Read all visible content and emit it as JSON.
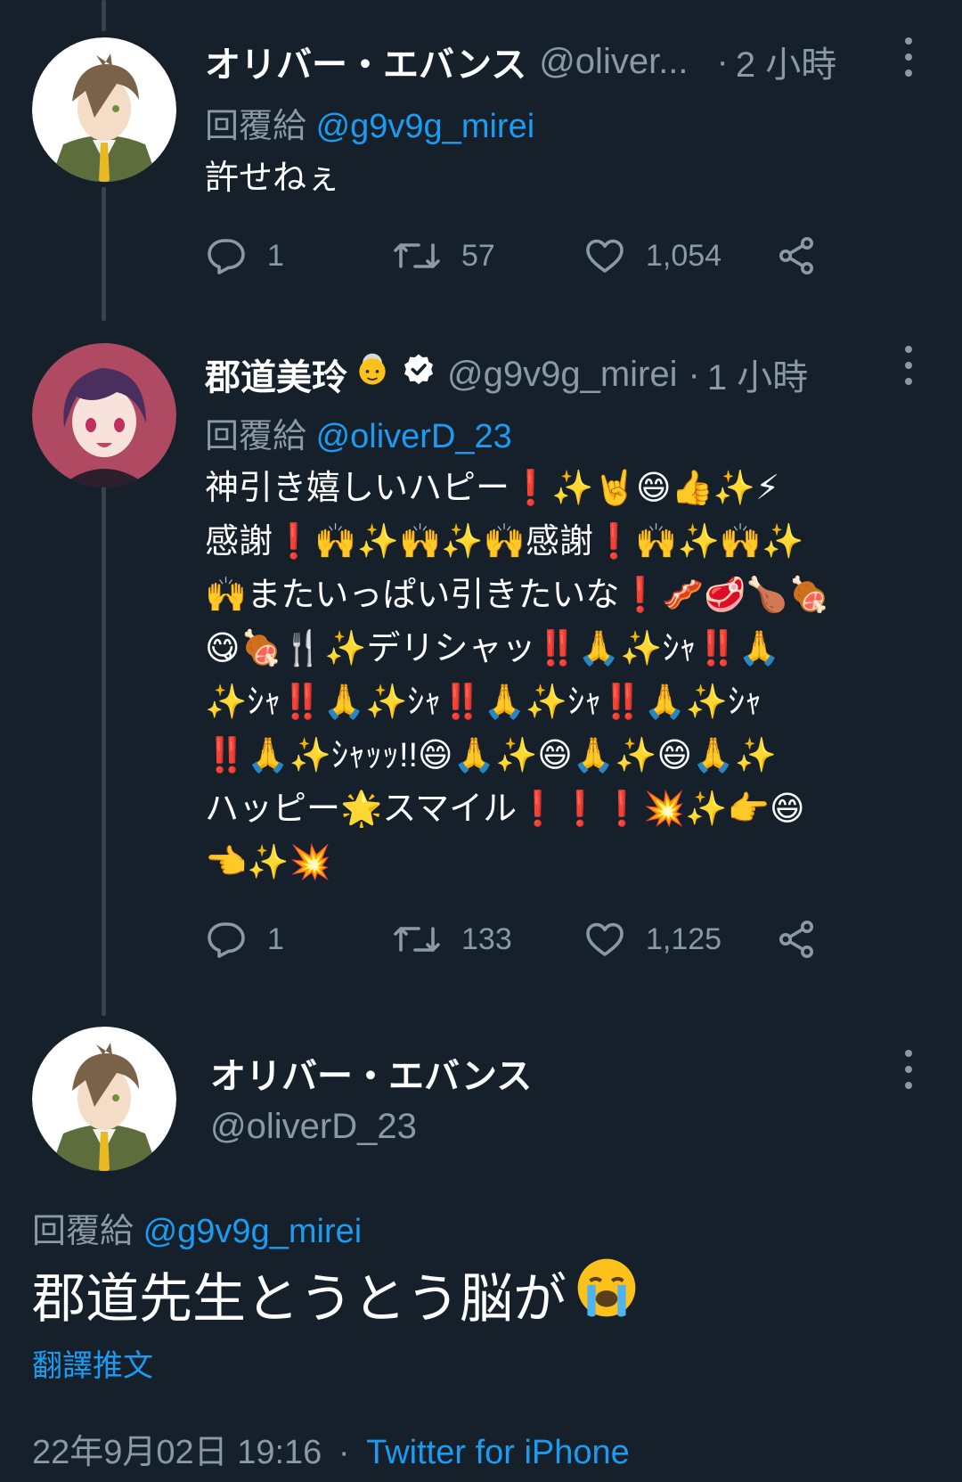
{
  "tweets": [
    {
      "display_name": "オリバー・エバンス",
      "handle": "@oliver...",
      "separator": "·",
      "time": "2 小時",
      "reply_prefix": "回覆給",
      "reply_mention": "@g9v9g_mirei",
      "text": "許せねぇ",
      "replies": "1",
      "retweets": "57",
      "likes": "1,054"
    },
    {
      "display_name": "郡道美玲",
      "handle": "@g9v9g_mirei",
      "separator": "·",
      "time": "1 小時",
      "reply_prefix": "回覆給",
      "reply_mention": "@oliverD_23",
      "text_lines": [
        "神引き嬉しいハピー❗✨🤘😄👍✨⚡",
        "感謝❗🙌✨🙌✨🙌感謝❗🙌✨🙌✨",
        "🙌またいっぱい引きたいな❗🥓🥩🍗🍖",
        "😋🍖🍴✨デリシャッ‼️🙏✨ｼｬ‼️🙏",
        "✨ｼｬ‼️🙏✨ｼｬ‼️🙏✨ｼｬ‼️🙏✨ｼｬ",
        "‼️🙏✨ｼｬｯｯ!!😄🙏✨😄🙏✨😄🙏✨",
        "ハッピー🌟スマイル❗❗❗💥✨👉😄",
        "👈✨💥"
      ],
      "replies": "1",
      "retweets": "133",
      "likes": "1,125"
    }
  ],
  "main_tweet": {
    "display_name": "オリバー・エバンス",
    "handle": "@oliverD_23",
    "reply_prefix": "回覆給",
    "reply_mention": "@g9v9g_mirei",
    "text": "郡道先生とうとう脳が",
    "translate_label": "翻譯推文",
    "date": "22年9月02日 19:16",
    "separator": "·",
    "source": "Twitter for iPhone"
  },
  "colors": {
    "background": "#15202b",
    "text_primary": "#ffffff",
    "text_secondary": "#8b98a5",
    "accent": "#1d9bf0",
    "thread_line": "#38444d"
  },
  "icons": [
    "more-options-icon",
    "reply-icon",
    "retweet-icon",
    "like-icon",
    "share-icon",
    "verified-badge-icon",
    "crying-face-icon",
    "elder-woman-emoji-icon"
  ]
}
